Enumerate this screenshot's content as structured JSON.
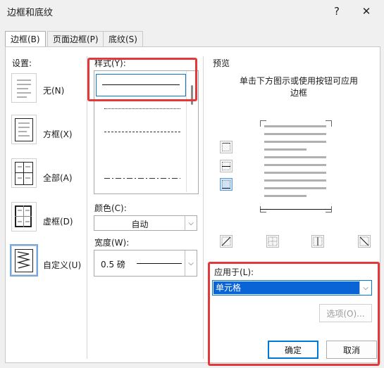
{
  "window": {
    "title": "边框和底纹",
    "help_label": "?",
    "close_label": "✕"
  },
  "tabs": [
    {
      "label": "边框(B)",
      "active": true
    },
    {
      "label": "页面边框(P)",
      "active": false
    },
    {
      "label": "底纹(S)",
      "active": false
    }
  ],
  "settings": {
    "heading": "设置:",
    "items": [
      {
        "label": "无(N)",
        "icon": "none-border-icon"
      },
      {
        "label": "方框(X)",
        "icon": "box-border-icon"
      },
      {
        "label": "全部(A)",
        "icon": "all-border-icon"
      },
      {
        "label": "虚框(D)",
        "icon": "grid-border-icon"
      },
      {
        "label": "自定义(U)",
        "icon": "custom-border-icon",
        "selected": true
      }
    ]
  },
  "style": {
    "heading": "样式(Y):",
    "line_styles": [
      "solid",
      "dotted",
      "small-dash",
      "dash",
      "dash-dot"
    ],
    "color_label": "颜色(C):",
    "color_value": "自动",
    "width_label": "宽度(W):",
    "width_value": "0.5 磅"
  },
  "preview": {
    "heading": "预览",
    "instruction": "单击下方图示或使用按钮可应用边框"
  },
  "apply_to": {
    "label": "应用于(L):",
    "value": "单元格",
    "options_button": "选项(O)..."
  },
  "footer": {
    "ok": "确定",
    "cancel": "取消"
  },
  "colors": {
    "accent": "#0078d7",
    "highlight": "#e23a3a",
    "selection": "#0a64d6"
  }
}
